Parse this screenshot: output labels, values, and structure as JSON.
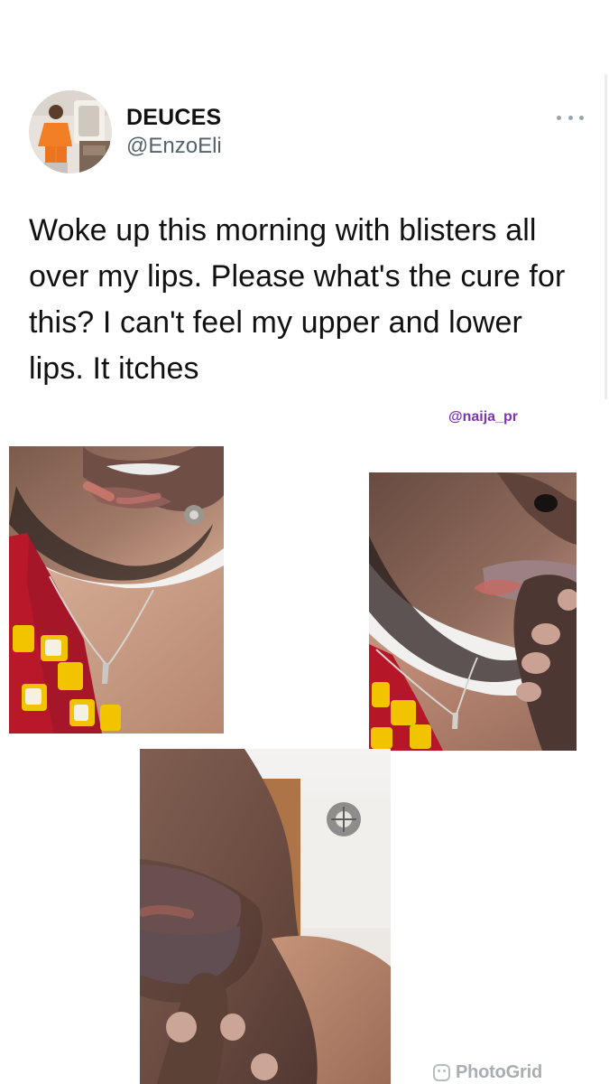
{
  "tweet": {
    "display_name": "DEUCES",
    "handle": "@EnzoEli",
    "text": "Woke up this morning with blisters all over my lips. Please what's the cure for this? I can't feel my upper and lower lips. It itches",
    "more_icon": "more-horizontal-icon"
  },
  "overlay": {
    "watermark": "@naija_pr",
    "photogrid_label": "PhotoGrid",
    "photogrid_icon": "photogrid-logo-icon"
  },
  "colors": {
    "watermark": "#7b35b3",
    "handle": "#55626c",
    "text": "#111111",
    "photogrid": "#a8adb3"
  }
}
